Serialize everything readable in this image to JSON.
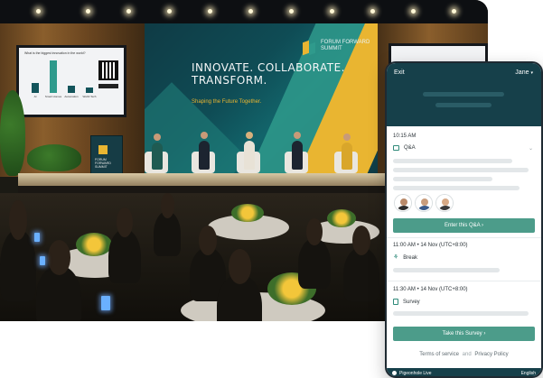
{
  "photo": {
    "backdrop_headline": "INNOVATE. COLLABORATE. TRANSFORM.",
    "backdrop_tagline": "Shaping the Future Together.",
    "logo_text": "FORUM FORWARD SUMMIT",
    "podium_text": "FORUM FORWARD SUMMIT",
    "screen_question": "What is the biggest innovation in the world?",
    "screen_bars": [
      {
        "label": "AI",
        "value": 0.3
      },
      {
        "label": "Smart Homes",
        "value": 1.0
      },
      {
        "label": "Automation",
        "value": 0.22
      },
      {
        "label": "Web3 Tech",
        "value": 0.18
      }
    ]
  },
  "app": {
    "header": {
      "exit_label": "Exit",
      "user_label": "Jane",
      "user_chevron": "▾"
    },
    "sessions": [
      {
        "time": "10:15 AM",
        "type_label": "Q&A",
        "type_icon": "qa-icon",
        "action_label": "Enter this Q&A ›"
      },
      {
        "time": "11:00 AM • 14 Nov (UTC+8:00)",
        "type_label": "Break",
        "type_icon": "leaf-icon"
      },
      {
        "time": "11:30 AM • 14 Nov (UTC+8:00)",
        "type_label": "Survey",
        "type_icon": "survey-icon",
        "action_label": "Take this Survey ›"
      }
    ],
    "footer": {
      "terms_label": "Terms of service",
      "and_label": "and",
      "privacy_label": "Privacy Policy"
    },
    "bottom_bar": {
      "brand_label": "Pigeonhole Live",
      "language_label": "English"
    },
    "colors": {
      "header_bg": "#16404a",
      "button_bg": "#4c9c8a",
      "accent_icon": "#2f8a7a"
    }
  }
}
